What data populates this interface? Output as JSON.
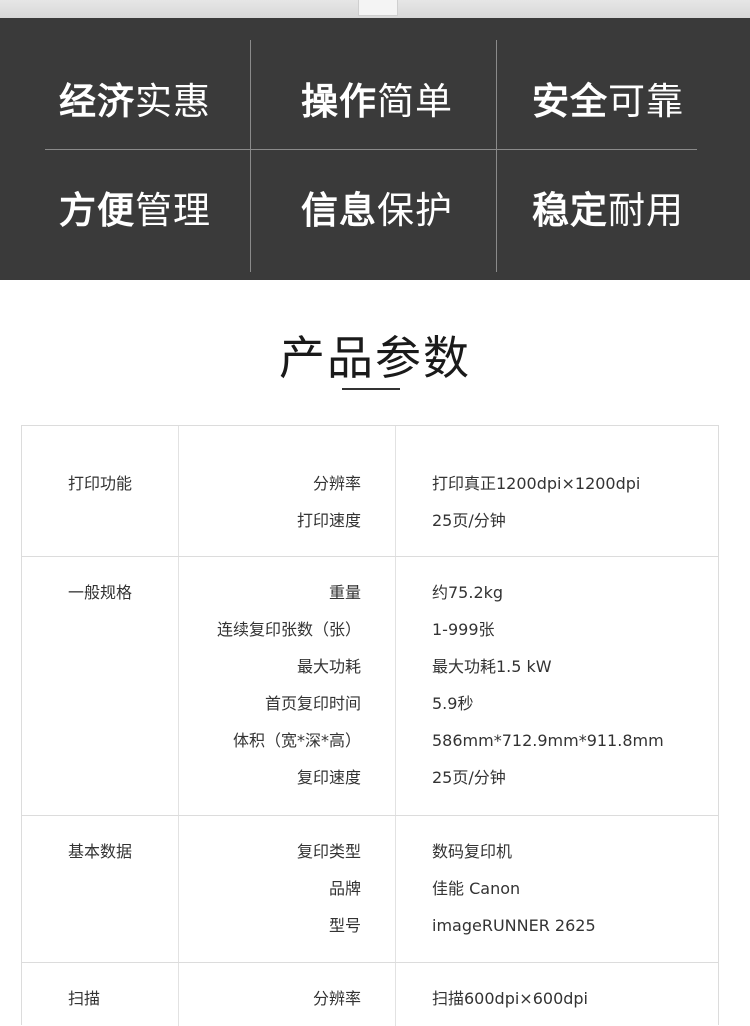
{
  "features": [
    {
      "bold": "经济",
      "light": "实惠"
    },
    {
      "bold": "操作",
      "light": "简单"
    },
    {
      "bold": "安全",
      "light": "可靠"
    },
    {
      "bold": "方便",
      "light": "管理"
    },
    {
      "bold": "信息",
      "light": "保护"
    },
    {
      "bold": "稳定",
      "light": "耐用"
    }
  ],
  "section_title": "产品参数",
  "spec_groups": [
    {
      "title": "打印功能",
      "rows": [
        {
          "label": "分辨率",
          "value": "打印真正1200dpi×1200dpi"
        },
        {
          "label": "打印速度",
          "value": "25页/分钟"
        }
      ]
    },
    {
      "title": "一般规格",
      "rows": [
        {
          "label": "重量",
          "value": "约75.2kg"
        },
        {
          "label": "连续复印张数（张）",
          "value": "1-999张"
        },
        {
          "label": "最大功耗",
          "value": "最大功耗1.5 kW"
        },
        {
          "label": "首页复印时间",
          "value": "5.9秒"
        },
        {
          "label": "体积（宽*深*高）",
          "value": "586mm*712.9mm*911.8mm"
        },
        {
          "label": "复印速度",
          "value": "25页/分钟"
        }
      ]
    },
    {
      "title": "基本数据",
      "rows": [
        {
          "label": "复印类型",
          "value": "数码复印机"
        },
        {
          "label": "品牌",
          "value": "佳能 Canon"
        },
        {
          "label": "型号",
          "value": "imageRUNNER 2625"
        }
      ]
    },
    {
      "title": "扫描",
      "rows": [
        {
          "label": "分辨率",
          "value": "扫描600dpi×600dpi"
        }
      ]
    }
  ]
}
